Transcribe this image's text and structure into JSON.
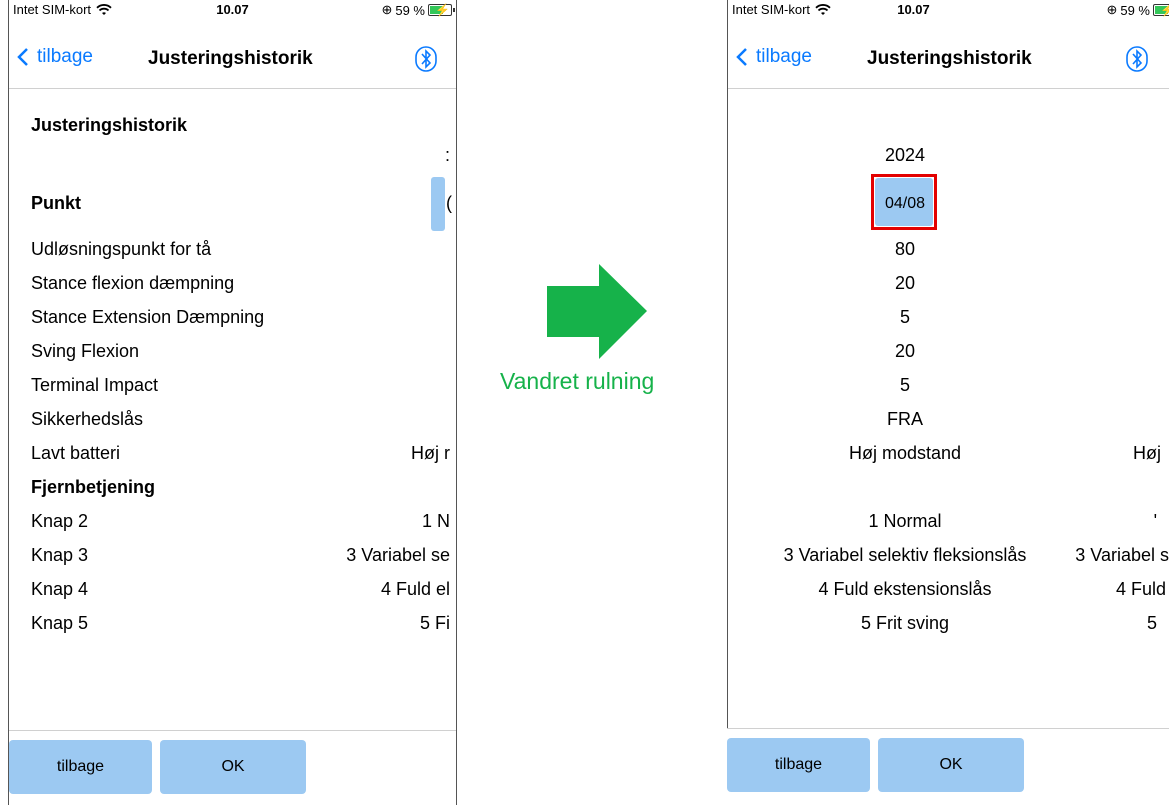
{
  "status": {
    "carrier": "Intet SIM-kort",
    "time": "10.07",
    "battery": "59 %"
  },
  "nav": {
    "back": "tilbage",
    "title": "Justeringshistorik"
  },
  "left": {
    "heading": "Justeringshistorik",
    "clip_date_char": ":",
    "punkt": "Punkt",
    "punkt_clip": "(",
    "rows": [
      {
        "label": "Udløsningspunkt for tå",
        "value": ""
      },
      {
        "label": "Stance flexion dæmpning",
        "value": ""
      },
      {
        "label": "Stance Extension Dæmpning",
        "value": ""
      },
      {
        "label": "Sving Flexion",
        "value": ""
      },
      {
        "label": "Terminal Impact",
        "value": ""
      },
      {
        "label": "Sikkerhedslås",
        "value": ""
      },
      {
        "label": "Lavt batteri",
        "value": "Høj r"
      }
    ],
    "remote_heading": "Fjernbetjening",
    "remote_rows": [
      {
        "label": "Knap 2",
        "value": "1 N"
      },
      {
        "label": "Knap 3",
        "value": "3 Variabel se"
      },
      {
        "label": "Knap 4",
        "value": "4 Fuld el"
      },
      {
        "label": "Knap 5",
        "value": "5 Fi"
      }
    ]
  },
  "right": {
    "year": "2024",
    "date": "04/08",
    "values": [
      "80",
      "20",
      "5",
      "20",
      "5",
      "FRA",
      "Høj modstand"
    ],
    "values_clip": "Høj",
    "remote_values": [
      "1 Normal",
      "3 Variabel selektiv fleksionslås",
      "4 Fuld ekstensionslås",
      "5 Frit sving"
    ],
    "remote_clip": [
      "'",
      "3 Variabel s",
      "4 Fuld",
      "5"
    ]
  },
  "buttons": {
    "back": "tilbage",
    "ok": "OK"
  },
  "annotation": {
    "label": "Vandret rulning",
    "color": "#16b24a"
  },
  "colors": {
    "accent": "#0a7aff",
    "cell": "#9cc9f2",
    "highlight": "#e30000"
  }
}
